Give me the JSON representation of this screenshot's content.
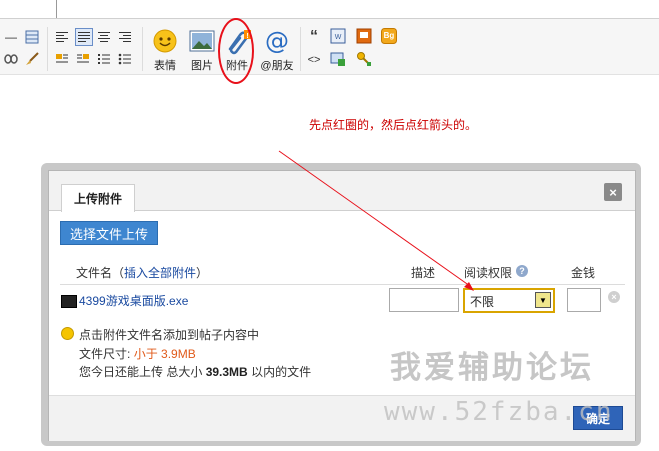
{
  "toolbar": {
    "icons_left": [
      "hr-icon",
      "table-icon",
      "link-unlink-icon",
      "brush-icon",
      "align-left-icon",
      "align-justify-icon",
      "align-center-icon",
      "align-right-icon",
      "float-left-icon",
      "float-right-icon",
      "ordered-list-icon",
      "unordered-list-icon"
    ],
    "smiley_label": "表情",
    "image_label": "图片",
    "attachment_label": "附件",
    "friends_label": "@朋友",
    "quote_glyph": "“",
    "code_glyph": "<>",
    "bg_label": "Bg"
  },
  "annotation": {
    "text": "先点红圈的，然后点红箭头的。",
    "color": "#cc0000"
  },
  "dialog": {
    "tab_label": "上传附件",
    "close_glyph": "×",
    "upload_button": "选择文件上传",
    "columns": {
      "filename": "文件名",
      "insert_prefix": "（",
      "insert_link": "插入全部附件",
      "insert_suffix": "）",
      "desc": "描述",
      "perm": "阅读权限",
      "money": "金钱"
    },
    "file": {
      "name": "4399游戏桌面版.exe",
      "desc_value": "",
      "perm_value": "不限",
      "money_value": ""
    },
    "tips": {
      "line1": "点击附件文件名添加到帖子内容中",
      "line2_prefix": "文件尺寸:",
      "line2_size": "小于 3.9MB",
      "line3_prefix": "您今日还能上传 总大小",
      "line3_size": "39.3MB",
      "line3_suffix": "以内的文件"
    },
    "ok_button": "确定"
  },
  "watermark": {
    "line1": "我爱辅助论坛",
    "line2": "www.52fzba.cn"
  },
  "colors": {
    "accent_blue": "#3e86d0",
    "link_blue": "#1a4aa0",
    "highlight_red": "#e8101a",
    "size_orange": "#e05a1a"
  }
}
